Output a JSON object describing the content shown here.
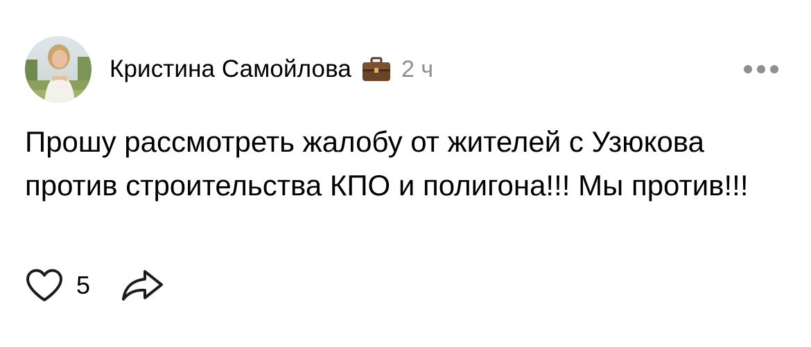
{
  "post": {
    "author": "Кристина Самойлова",
    "badge_icon": "briefcase-icon",
    "timestamp": "2 ч",
    "more_icon": "more-dots-icon",
    "text": "Прошу рассмотреть жалобу от жителей с Узюкова против строительства КПО и полигона!!! Мы против!!!",
    "likes": {
      "icon": "heart-icon",
      "count": "5"
    },
    "share_icon": "share-arrow-icon"
  },
  "colors": {
    "text": "#000000",
    "secondary_text": "#8e8e93",
    "icon_stroke": "#1c1c1e"
  }
}
